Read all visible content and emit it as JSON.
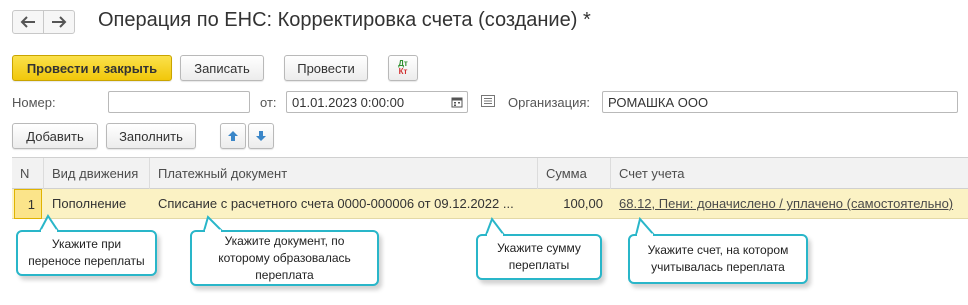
{
  "window": {
    "title": "Операция по ЕНС: Корректировка счета (создание) *"
  },
  "nav": {
    "back_icon": "arrow-left-icon",
    "forward_icon": "arrow-right-icon"
  },
  "toolbar": {
    "post_close_label": "Провести и закрыть",
    "save_label": "Записать",
    "post_label": "Провести",
    "dtkt_top": "Дт",
    "dtkt_bottom": "Кт"
  },
  "form": {
    "number_label": "Номер:",
    "number_value": "",
    "date_label": "от:",
    "date_value": "01.01.2023  0:00:00",
    "org_label": "Организация:",
    "org_value": "РОМАШКА ООО"
  },
  "table_toolbar": {
    "add_label": "Добавить",
    "fill_label": "Заполнить"
  },
  "table": {
    "columns": [
      "N",
      "Вид движения",
      "Платежный документ",
      "Сумма",
      "Счет учета"
    ],
    "rows": [
      {
        "n": "1",
        "movement": "Пополнение",
        "document": "Списание с расчетного счета 0000-000006 от 09.12.2022 ...",
        "amount": "100,00",
        "account": "68.12, Пени: доначислено / уплачено (самостоятельно)"
      }
    ]
  },
  "callouts": [
    {
      "text": "Укажите при переносе переплаты"
    },
    {
      "text": "Укажите документ, по которому образовалась переплата"
    },
    {
      "text": "Укажите сумму переплаты"
    },
    {
      "text": "Укажите счет, на котором учитывалась переплата"
    }
  ],
  "colors": {
    "primary_button": "#f5d21e",
    "row_highlight": "#fbf2c4",
    "callout_border": "#29b6c9"
  }
}
